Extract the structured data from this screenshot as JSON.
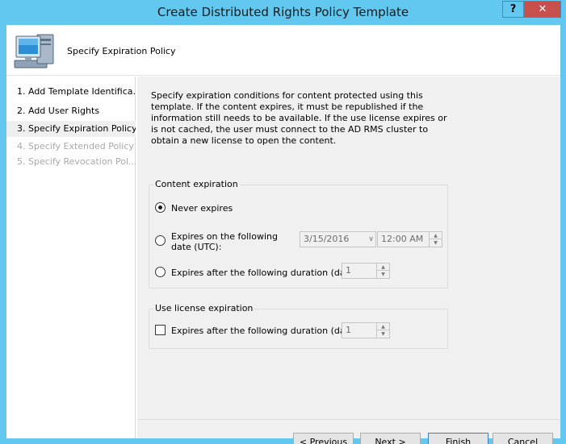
{
  "window": {
    "title": "Create Distributed Rights Policy Template",
    "help_label": "?",
    "close_label": "✕"
  },
  "header": {
    "title": "Specify Expiration Policy",
    "icon": "computer-icon"
  },
  "nav": {
    "items": [
      {
        "label": "1. Add Template Identifica...",
        "state": "normal"
      },
      {
        "label": "2. Add User Rights",
        "state": "normal"
      },
      {
        "label": "3. Specify Expiration Policy",
        "state": "current"
      },
      {
        "label": "4. Specify Extended Policy",
        "state": "disabled"
      },
      {
        "label": "5. Specify Revocation Pol...",
        "state": "disabled"
      }
    ]
  },
  "content": {
    "description": "Specify expiration conditions for content protected using this template. If the content expires, it must be republished if the information still needs to be available. If the use license expires or is not cached, the user must connect to the AD RMS cluster to obtain a new license to open the content.",
    "content_expiration": {
      "label": "Content expiration",
      "never_expires_label": "Never expires",
      "never_expires_checked": true,
      "date_option_label": "Expires on the following date (UTC):",
      "date_value": "3/15/2016",
      "time_value": "12:00 AM",
      "duration_option_label": "Expires after the following duration (days):",
      "duration_value": "1"
    },
    "use_license_expiration": {
      "label": "Use license expiration",
      "checkbox_label": "Expires after the following duration (days):",
      "checked": false,
      "duration_value": "1"
    }
  },
  "buttons": {
    "previous": "< Previous",
    "next": "Next >",
    "finish": "Finish",
    "cancel": "Cancel"
  }
}
